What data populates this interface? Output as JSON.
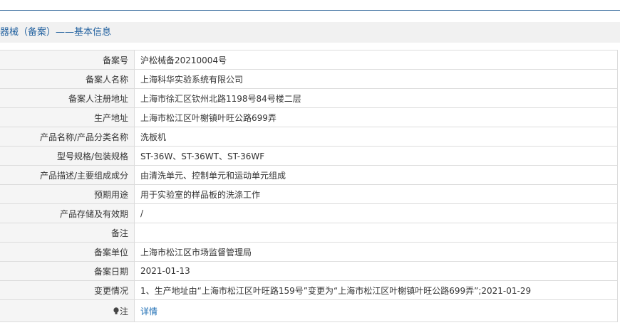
{
  "header": {
    "title": "器械（备案）——基本信息"
  },
  "rows": [
    {
      "label": "备案号",
      "value": "沪松械备20210004号"
    },
    {
      "label": "备案人名称",
      "value": "上海科华实验系统有限公司"
    },
    {
      "label": "备案人注册地址",
      "value": "上海市徐汇区钦州北路1198号84号楼二层"
    },
    {
      "label": "生产地址",
      "value": "上海市松江区叶榭镇叶旺公路699弄"
    },
    {
      "label": "产品名称/产品分类名称",
      "value": "洗板机"
    },
    {
      "label": "型号规格/包装规格",
      "value": "ST-36W、ST-36WT、ST-36WF"
    },
    {
      "label": "产品描述/主要组成成分",
      "value": "由清洗单元、控制单元和运动单元组成"
    },
    {
      "label": "预期用途",
      "value": "用于实验室的样品板的洗涤工作"
    },
    {
      "label": "产品存储及有效期",
      "value": "/"
    },
    {
      "label": "备注",
      "value": ""
    },
    {
      "label": "备案单位",
      "value": "上海市松江区市场监督管理局"
    },
    {
      "label": "备案日期",
      "value": "2021-01-13"
    },
    {
      "label": "变更情况",
      "value": "1、生产地址由“上海市松江区叶旺路159号”变更为“上海市松江区叶榭镇叶旺公路699弄”;2021-01-29"
    }
  ],
  "note_row": {
    "label": "注",
    "icon": "lightbulb-icon",
    "link_text": "详情"
  },
  "colors": {
    "accent": "#1f5f9e",
    "link": "#1f6fb5",
    "label_bg": "#f5f5f5",
    "border": "#dcdcdc"
  }
}
